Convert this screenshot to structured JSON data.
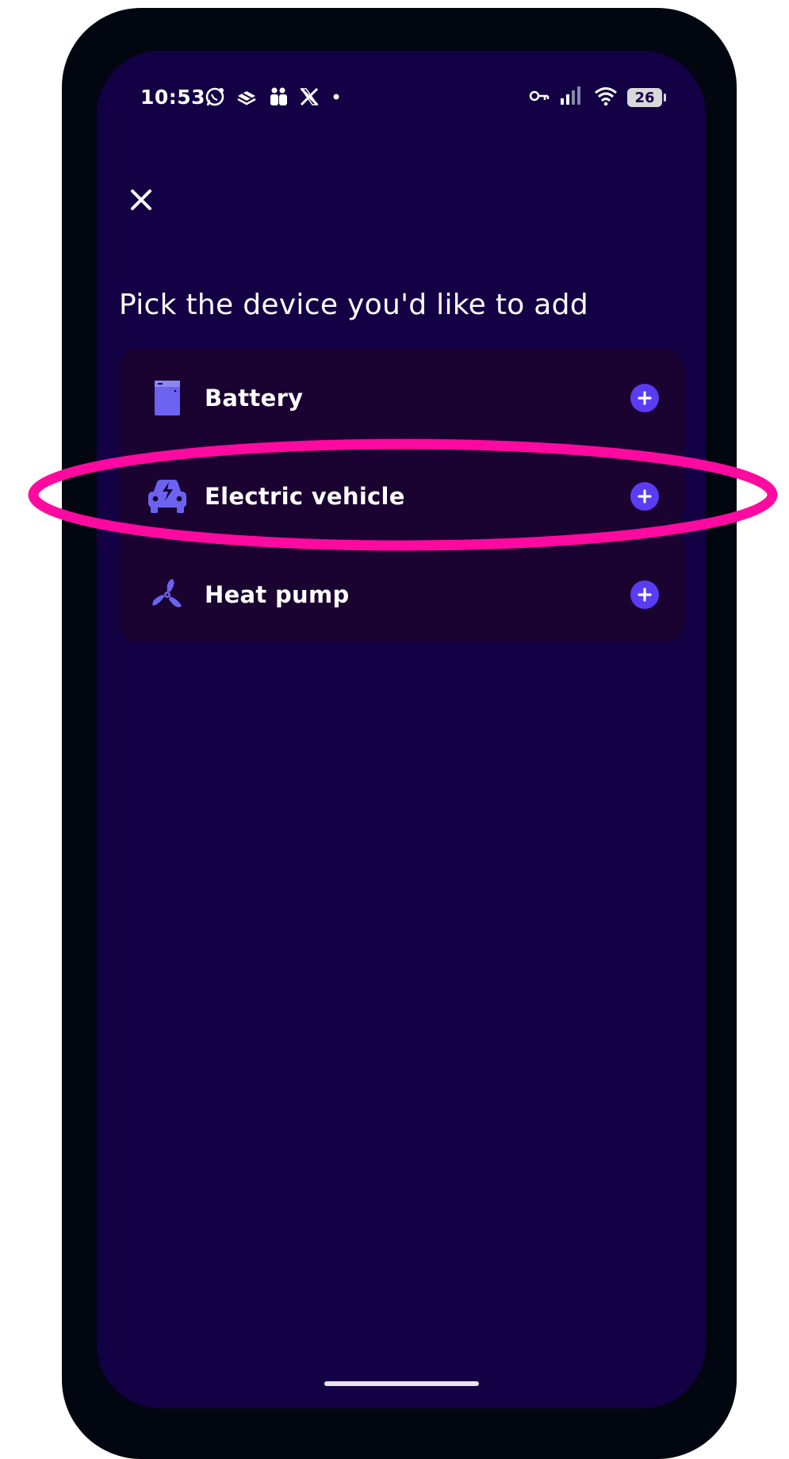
{
  "status_bar": {
    "time": "10:53",
    "battery_level": "26",
    "notification_icons": [
      "whatsapp-icon",
      "stack-icon",
      "teams-icon",
      "x-icon",
      "dot-icon"
    ],
    "system_icons": [
      "vpn-key-icon",
      "signal-icon",
      "wifi-icon",
      "battery-icon"
    ]
  },
  "header": {
    "close_icon": "close-icon"
  },
  "main": {
    "title": "Pick the device you'd like to add",
    "devices": [
      {
        "label": "Battery",
        "icon": "battery-device-icon",
        "action_icon": "plus-icon"
      },
      {
        "label": "Electric vehicle",
        "icon": "car-charging-icon",
        "action_icon": "plus-icon"
      },
      {
        "label": "Heat pump",
        "icon": "fan-icon",
        "action_icon": "plus-icon"
      }
    ]
  },
  "annotation": {
    "highlight_target": "Electric vehicle",
    "color": "#ff0aa0"
  },
  "colors": {
    "screen_bg": "#140045",
    "card_bg": "#1a0330",
    "accent": "#5b3cf5",
    "icon": "#6b63f0"
  }
}
